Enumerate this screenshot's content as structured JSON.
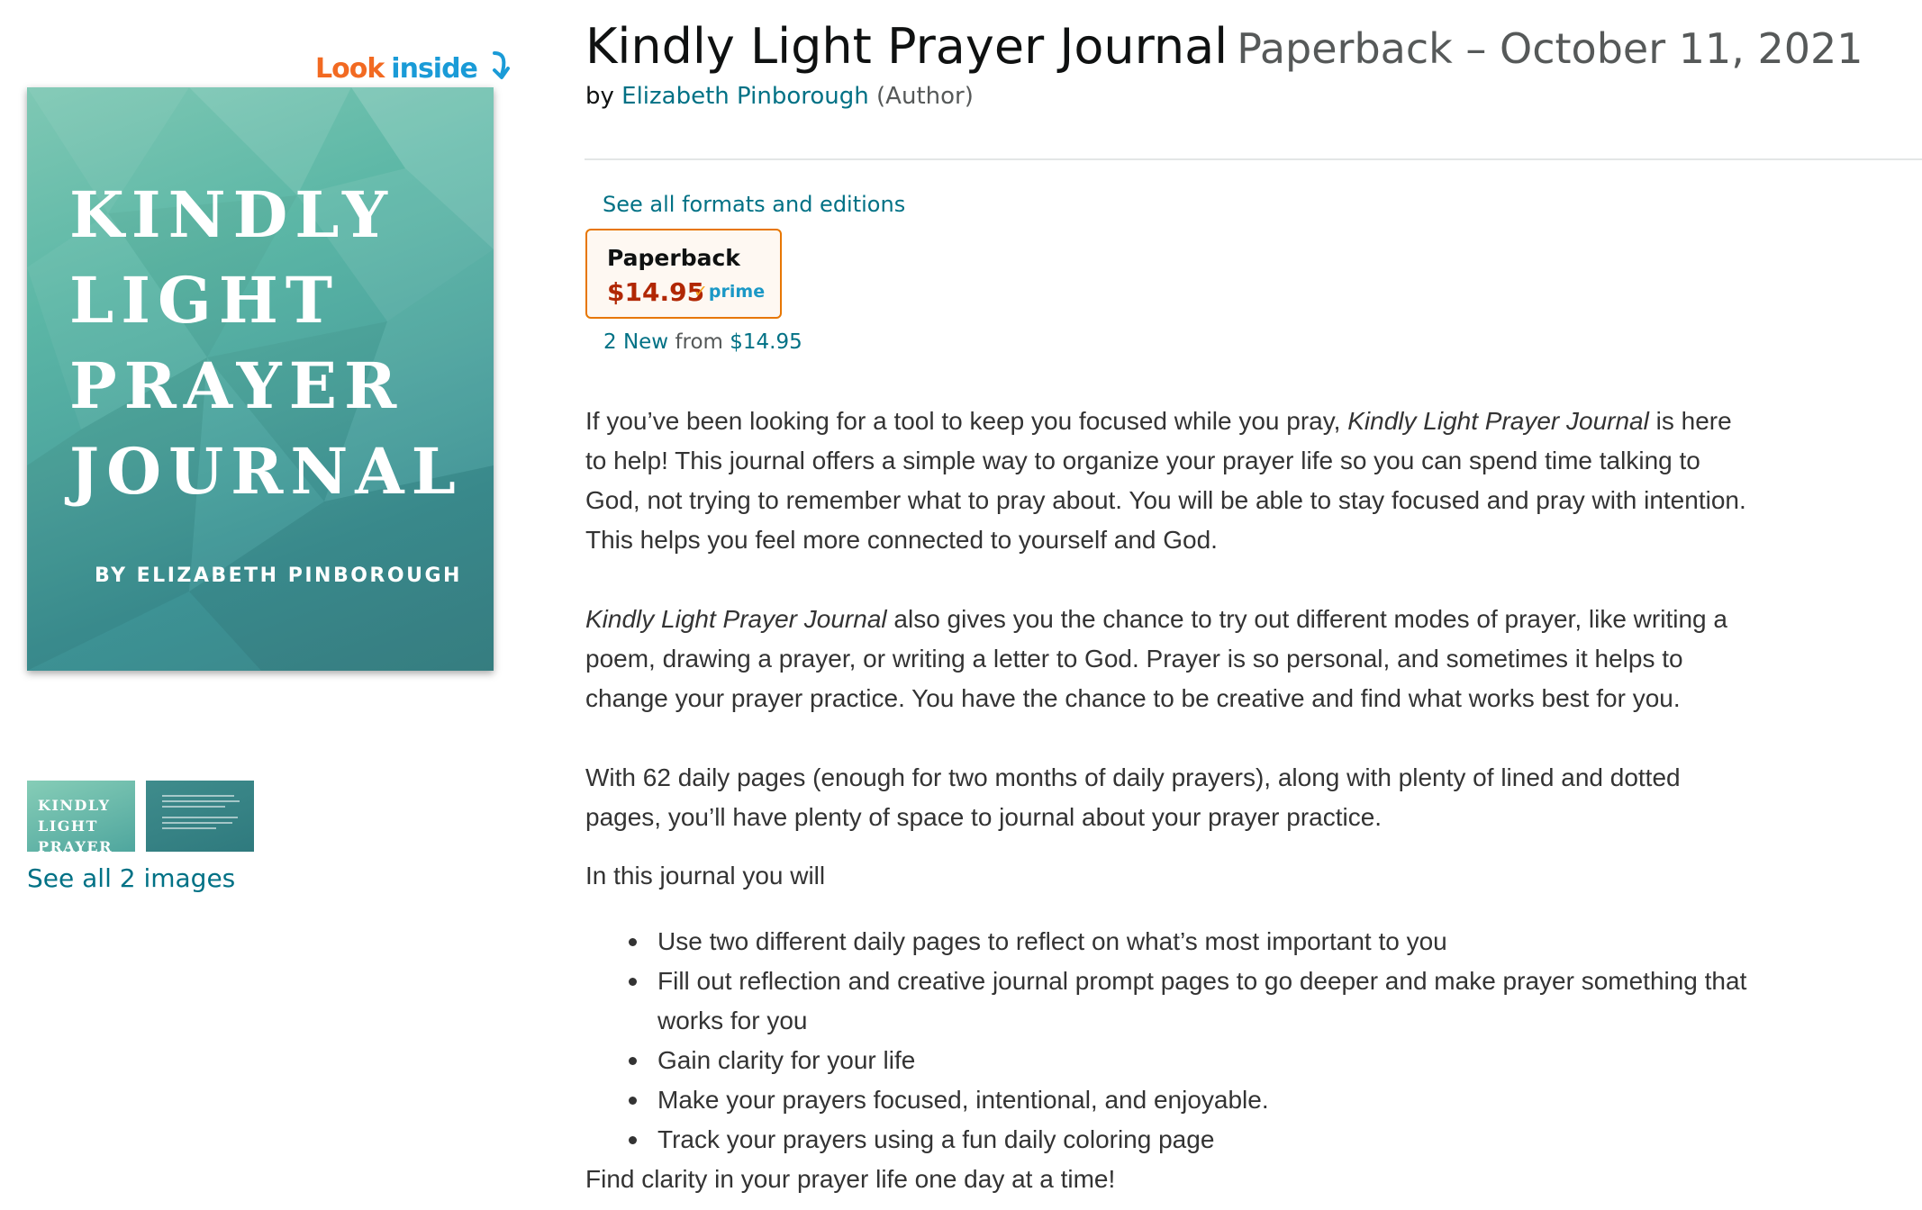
{
  "look_inside": {
    "word1": "Look",
    "word2": "inside",
    "icon": "curved-down-arrow-icon"
  },
  "cover": {
    "title_lines": [
      "KINDLY",
      "LIGHT",
      "PRAYER",
      "JOURNAL"
    ],
    "author": "BY ELIZABETH PINBOROUGH"
  },
  "thumbnails": {
    "thumb1_lines": [
      "KINDLY",
      "LIGHT",
      "PRAYER"
    ],
    "see_all": "See all 2 images"
  },
  "product": {
    "title": "Kindly Light Prayer Journal",
    "subtitle": "Paperback – October 11, 2021",
    "by": "by",
    "author": "Elizabeth Pinborough",
    "role": "(Author)"
  },
  "formats": {
    "see_all_link": "See all formats and editions",
    "selected": {
      "name": "Paperback",
      "price": "$14.95",
      "badge": "prime",
      "badge_icon": "prime-check-icon"
    },
    "new_count": "2 New",
    "from_label": "from",
    "from_price": "$14.95"
  },
  "colors": {
    "link": "#007185",
    "price": "#b12704",
    "selected_border": "#e77600",
    "prime": "#1a98c6"
  },
  "description": {
    "p1_a": "If you’ve been looking for a tool to keep you focused while you pray, ",
    "p1_em": "Kindly Light Prayer Journal",
    "p1_b": " is here to help! This journal offers a simple way to organize your prayer life so you can spend time talking to God, not trying to remember what to pray about. You will be able to stay focused and pray with intention. This helps you feel more connected to yourself and God.",
    "p2_em": "Kindly Light Prayer Journal",
    "p2_b": " also gives you the chance to try out different modes of prayer, like writing a poem, drawing a prayer, or writing a letter to God. Prayer is so personal, and sometimes it helps to change your prayer practice. You have the chance to be creative and find what works best for you.",
    "p3": "With 62 daily pages (enough for two months of daily prayers), along with plenty of lined and dotted pages, you’ll have plenty of space to journal about your prayer practice.",
    "p4": "In this journal you will",
    "bullets": [
      "Use two different daily pages to reflect on what’s most important to you",
      "Fill out reflection and creative journal prompt pages to go deeper and make prayer something that works for you",
      "Gain clarity for your life",
      "Make your prayers focused, intentional, and enjoyable.",
      "Track your prayers using a fun daily coloring page"
    ],
    "closing": "Find clarity in your prayer life one day at a time!"
  }
}
